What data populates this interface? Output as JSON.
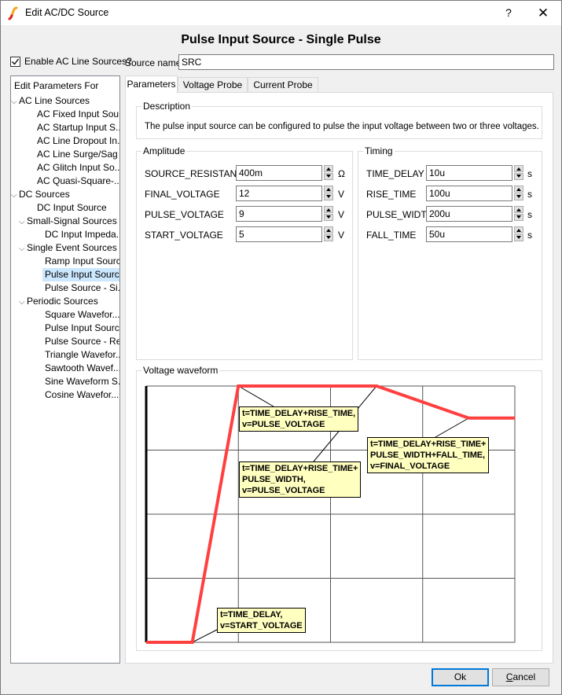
{
  "window": {
    "title": "Edit AC/DC Source",
    "help_label": "?",
    "close_label": "✕",
    "icon": "simetrix-app-icon"
  },
  "heading": "Pulse Input Source - Single Pulse",
  "enable_ac": {
    "label": "Enable AC Line Sources?",
    "checked": true
  },
  "source_name": {
    "label": "Source name",
    "value": "SRC"
  },
  "tree": {
    "header": "Edit Parameters For",
    "items": [
      {
        "label": "AC Line Sources",
        "level": 0,
        "expanded": true
      },
      {
        "label": "AC Fixed Input Sou...",
        "level": 1
      },
      {
        "label": "AC Startup Input S...",
        "level": 1
      },
      {
        "label": "AC Line Dropout In...",
        "level": 1
      },
      {
        "label": "AC Line Surge/Sag ...",
        "level": 1
      },
      {
        "label": "AC Glitch Input So...",
        "level": 1
      },
      {
        "label": "AC Quasi-Square-...",
        "level": 1
      },
      {
        "label": "DC Sources",
        "level": 0,
        "expanded": true
      },
      {
        "label": "DC Input Source",
        "level": 1
      },
      {
        "label": "Small-Signal Sources",
        "level": 1,
        "expanded": true
      },
      {
        "label": "DC Input Impeda...",
        "level": 2
      },
      {
        "label": "Single Event Sources",
        "level": 1,
        "expanded": true
      },
      {
        "label": "Ramp Input Source",
        "level": 2
      },
      {
        "label": "Pulse Input Sourc...",
        "level": 2,
        "selected": true
      },
      {
        "label": "Pulse Source - Si...",
        "level": 2
      },
      {
        "label": "Periodic Sources",
        "level": 1,
        "expanded": true
      },
      {
        "label": "Square Wavefor...",
        "level": 2
      },
      {
        "label": "Pulse Input Sourc...",
        "level": 2
      },
      {
        "label": "Pulse Source - Re...",
        "level": 2
      },
      {
        "label": "Triangle Wavefor...",
        "level": 2
      },
      {
        "label": "Sawtooth Wavef...",
        "level": 2
      },
      {
        "label": "Sine Waveform S...",
        "level": 2
      },
      {
        "label": "Cosine Wavefor...",
        "level": 2
      }
    ]
  },
  "tabs": [
    {
      "label": "Parameters",
      "active": true
    },
    {
      "label": "Voltage Probe",
      "active": false
    },
    {
      "label": "Current Probe",
      "active": false
    }
  ],
  "description": {
    "title": "Description",
    "text": "The pulse input source can be configured to pulse the input voltage between two or three voltages."
  },
  "amplitude": {
    "title": "Amplitude",
    "params": [
      {
        "name": "SOURCE_RESISTANCE",
        "value": "400m",
        "unit": "Ω"
      },
      {
        "name": "FINAL_VOLTAGE",
        "value": "12",
        "unit": "V"
      },
      {
        "name": "PULSE_VOLTAGE",
        "value": "9",
        "unit": "V"
      },
      {
        "name": "START_VOLTAGE",
        "value": "5",
        "unit": "V"
      }
    ]
  },
  "timing": {
    "title": "Timing",
    "params": [
      {
        "name": "TIME_DELAY",
        "value": "10u",
        "unit": "s"
      },
      {
        "name": "RISE_TIME",
        "value": "100u",
        "unit": "s"
      },
      {
        "name": "PULSE_WIDTH",
        "value": "200u",
        "unit": "s"
      },
      {
        "name": "FALL_TIME",
        "value": "50u",
        "unit": "s"
      }
    ]
  },
  "waveform": {
    "title": "Voltage waveform",
    "line_color": "#ff4040",
    "callout_bg": "#ffffc0",
    "callouts": [
      "t=TIME_DELAY+RISE_TIME,\nv=PULSE_VOLTAGE",
      "t=TIME_DELAY+RISE_TIME+\nPULSE_WIDTH,\nv=PULSE_VOLTAGE",
      "t=TIME_DELAY+RISE_TIME+\nPULSE_WIDTH+FALL_TIME,\nv=FINAL_VOLTAGE",
      "t=TIME_DELAY,\nv=START_VOLTAGE"
    ]
  },
  "chart_data": {
    "type": "line",
    "title": "Voltage waveform",
    "xlabel": "",
    "ylabel": "",
    "grid": true,
    "schematic": true,
    "x_ticks": 4,
    "y_ticks": 4,
    "x_range": [
      0,
      4
    ],
    "y_range": [
      0,
      4
    ],
    "points": [
      {
        "x": 0.0,
        "y": 0.0
      },
      {
        "x": 0.5,
        "y": 0.0
      },
      {
        "x": 1.0,
        "y": 4.0
      },
      {
        "x": 2.5,
        "y": 4.0
      },
      {
        "x": 3.5,
        "y": 3.5
      },
      {
        "x": 4.0,
        "y": 3.5
      }
    ],
    "annotations": [
      {
        "text": "t=TIME_DELAY+RISE_TIME, v=PULSE_VOLTAGE",
        "point": 2
      },
      {
        "text": "t=TIME_DELAY+RISE_TIME+PULSE_WIDTH, v=PULSE_VOLTAGE",
        "point": 3
      },
      {
        "text": "t=TIME_DELAY+RISE_TIME+PULSE_WIDTH+FALL_TIME, v=FINAL_VOLTAGE",
        "point": 4
      },
      {
        "text": "t=TIME_DELAY, v=START_VOLTAGE",
        "point": 1
      }
    ]
  },
  "buttons": {
    "ok": "Ok",
    "cancel_mnemonic": "C",
    "cancel_rest": "ancel"
  }
}
